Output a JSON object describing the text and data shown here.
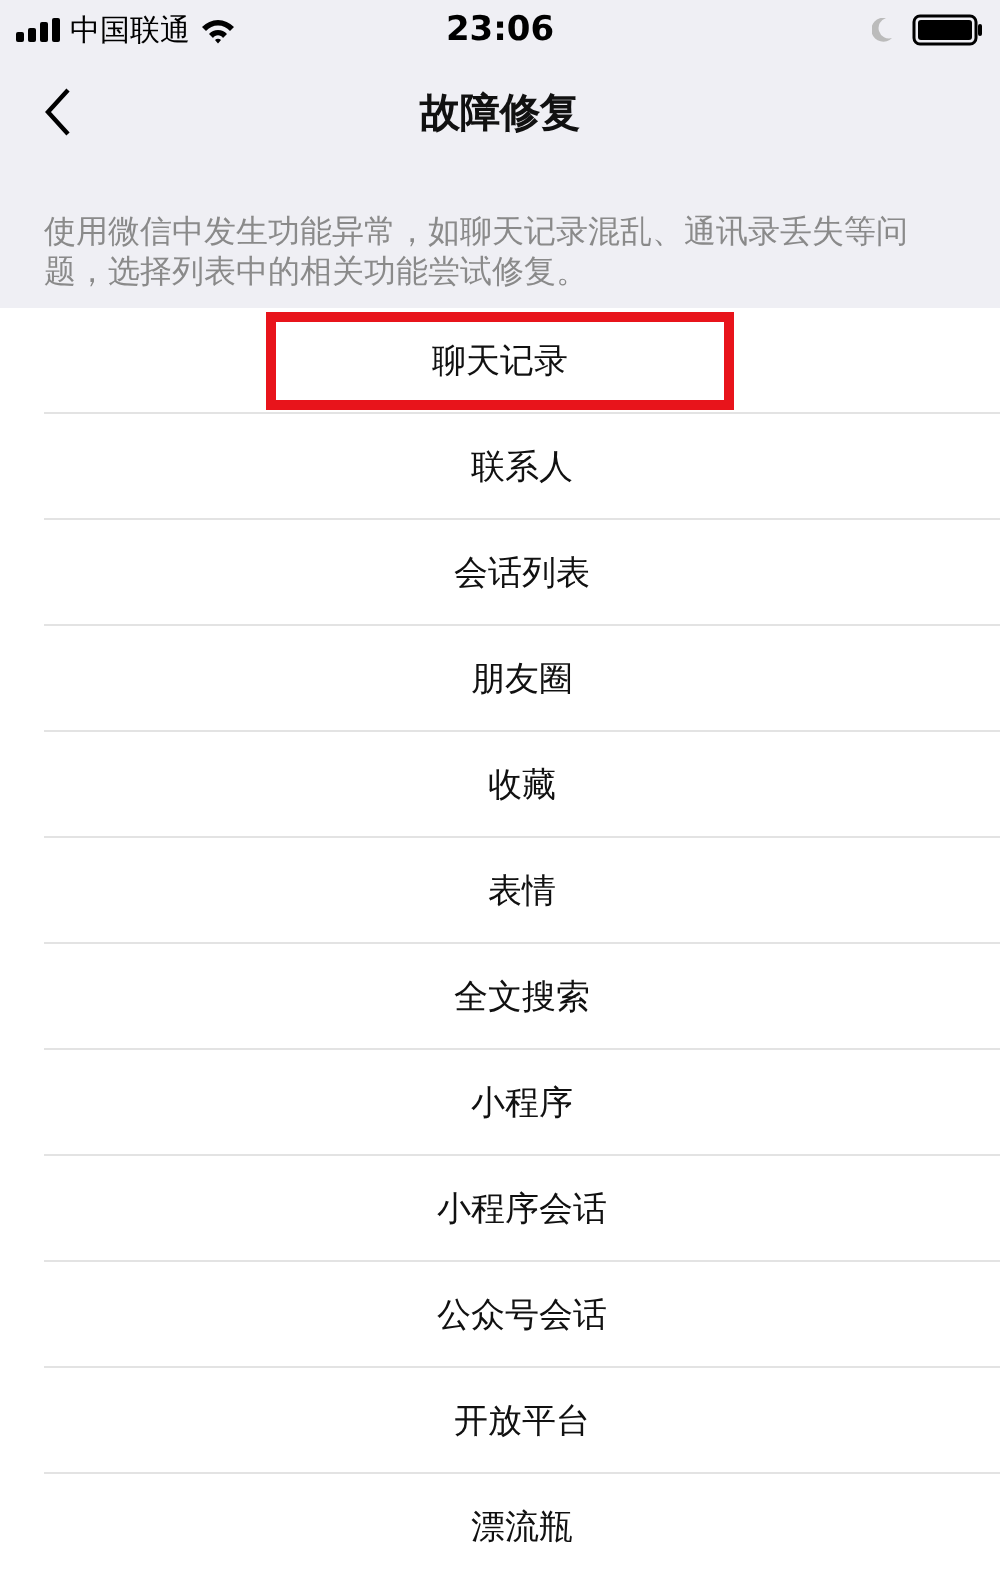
{
  "status_bar": {
    "carrier": "中国联通",
    "time": "23:06"
  },
  "nav": {
    "title": "故障修复"
  },
  "description": "使用微信中发生功能异常，如聊天记录混乱、通讯录丢失等问题，选择列表中的相关功能尝试修复。",
  "items": [
    {
      "label": "聊天记录",
      "highlighted": true
    },
    {
      "label": "联系人",
      "highlighted": false
    },
    {
      "label": "会话列表",
      "highlighted": false
    },
    {
      "label": "朋友圈",
      "highlighted": false
    },
    {
      "label": "收藏",
      "highlighted": false
    },
    {
      "label": "表情",
      "highlighted": false
    },
    {
      "label": "全文搜索",
      "highlighted": false
    },
    {
      "label": "小程序",
      "highlighted": false
    },
    {
      "label": "小程序会话",
      "highlighted": false
    },
    {
      "label": "公众号会话",
      "highlighted": false
    },
    {
      "label": "开放平台",
      "highlighted": false
    },
    {
      "label": "漂流瓶",
      "highlighted": false
    }
  ]
}
